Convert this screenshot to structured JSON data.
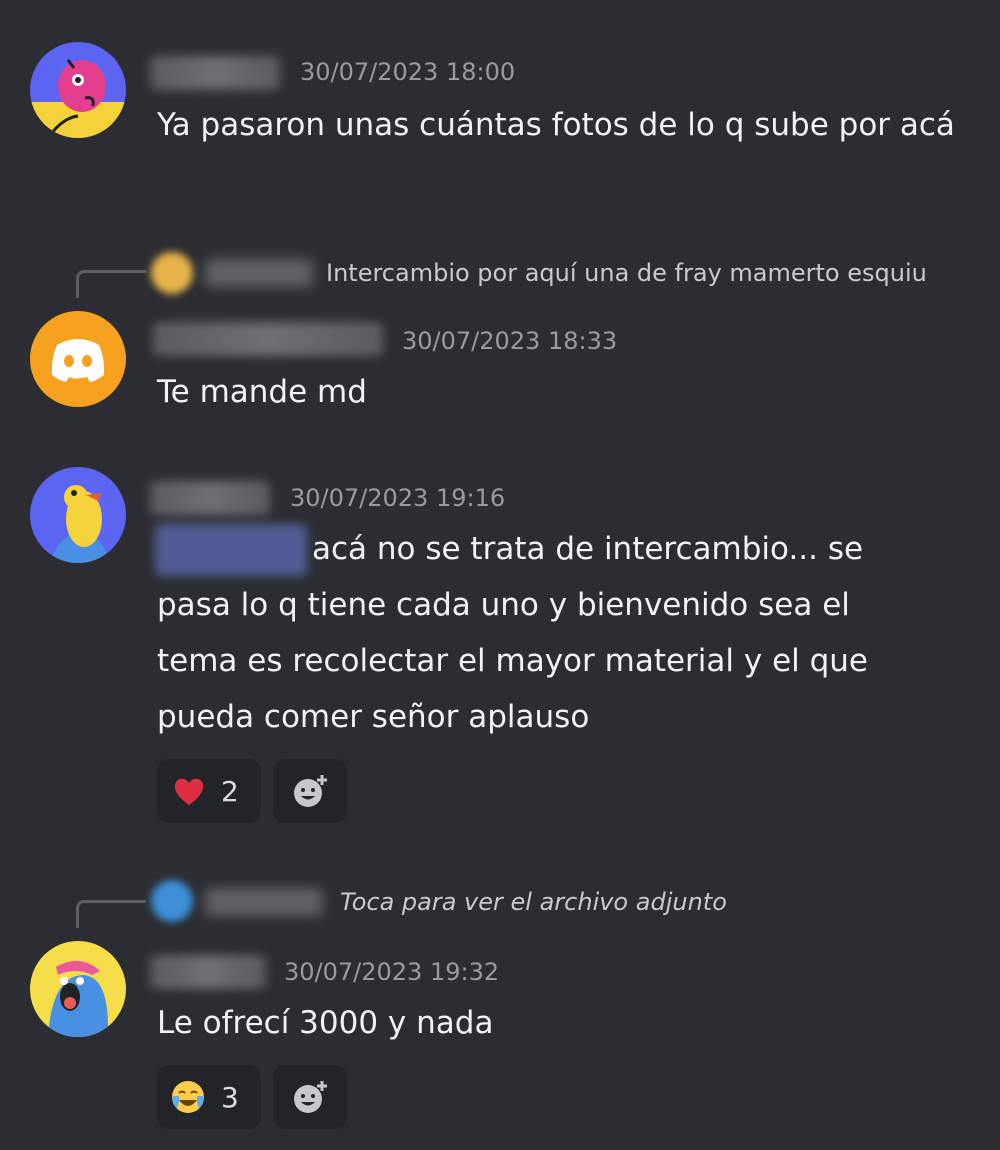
{
  "messages": [
    {
      "timestamp": "30/07/2023 18:00",
      "text": "Ya pasaron unas cuántas fotos de lo q sube por acá"
    },
    {
      "reply": {
        "text": "Intercambio por aquí una de fray mamerto esquiu"
      },
      "timestamp": "30/07/2023 18:33",
      "text": "Te mande md",
      "avatar_icon": "discord-icon"
    },
    {
      "timestamp": "30/07/2023 19:16",
      "text_after_mention": "acá no se trata de intercambio... se",
      "text_rest": "pasa lo q tiene cada uno y bienvenido sea el tema es recolectar el mayor material y el que pueda comer señor aplauso",
      "reactions": [
        {
          "emoji": "heart-icon",
          "count": "2"
        }
      ]
    },
    {
      "reply": {
        "text": "Toca para ver el archivo adjunto"
      },
      "timestamp": "30/07/2023 19:32",
      "text": "Le ofrecí 3000 y nada",
      "reactions": [
        {
          "emoji": "joy-icon",
          "count": "3"
        }
      ]
    }
  ],
  "colors": {
    "background": "#2c2d32",
    "timestamp": "#9a9ba1",
    "reaction_bg": "#232428",
    "discord_avatar": "#f6a11f"
  }
}
